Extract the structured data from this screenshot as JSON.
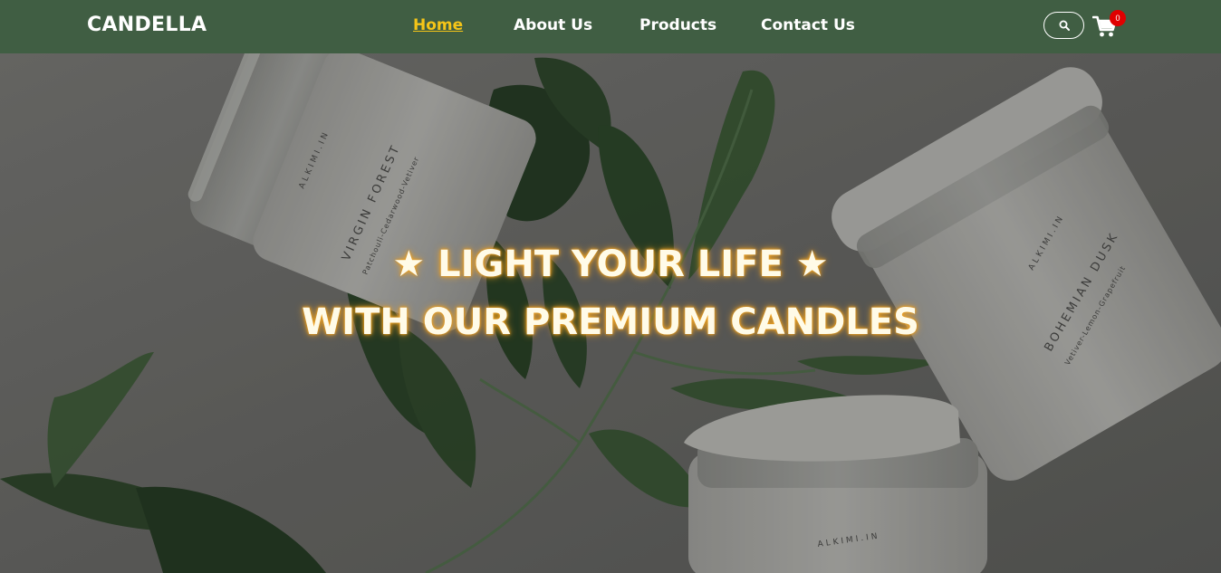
{
  "brand": "CANDELLA",
  "nav": {
    "items": [
      {
        "label": "Home",
        "active": true
      },
      {
        "label": "About Us",
        "active": false
      },
      {
        "label": "Products",
        "active": false
      },
      {
        "label": "Contact Us",
        "active": false
      }
    ]
  },
  "search": {
    "icon": "search-icon"
  },
  "cart": {
    "icon": "shopping-cart-icon",
    "count": "0"
  },
  "hero": {
    "line1": "★ LIGHT YOUR LIFE ★",
    "line2": "WITH OUR PREMIUM CANDLES",
    "jars": [
      {
        "brand": "ALKIMI.IN",
        "name": "VIRGIN FOREST",
        "notes": "Patchouli-Cedarwood-Vetiver"
      },
      {
        "brand": "ALKIMI.IN",
        "name": "BOHEMIAN DUSK",
        "notes": "Vetiver-Lemon-Grapefruit"
      },
      {
        "brand": "ALKIMI.IN"
      }
    ]
  },
  "colors": {
    "navbar": "#405e43",
    "active_link": "#f5c518",
    "badge": "#e00000",
    "hero_glow": "#f5a623"
  }
}
